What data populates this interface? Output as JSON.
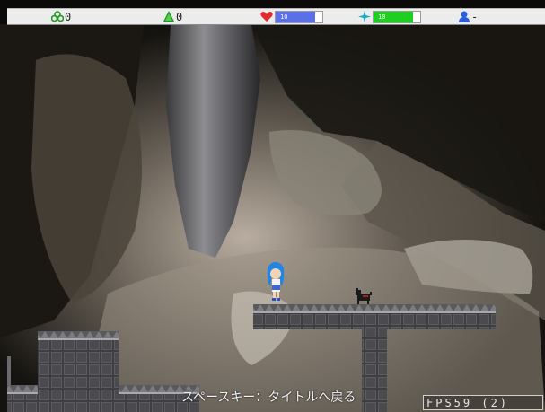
{
  "hud": {
    "clover_outline_count": "0",
    "clover_solid_count": "0",
    "heart_value": "10",
    "heart_level": 0.85,
    "star_value": "10",
    "star_level": 0.85,
    "player_value": "-",
    "colors": {
      "clover": "#1e9a1e",
      "heart": "#e32a2a",
      "heart_bar": "#5a6fe8",
      "star": "#22a7c9",
      "star_bar": "#1fcf1f",
      "player": "#2a5cd9"
    }
  },
  "footer": {
    "hint": "スペースキー：タイトルへ戻る",
    "fps": "FPS59 (2)"
  },
  "scene": {
    "player_sprite": "blue-haired-girl",
    "enemy_sprite": "black-dog"
  }
}
